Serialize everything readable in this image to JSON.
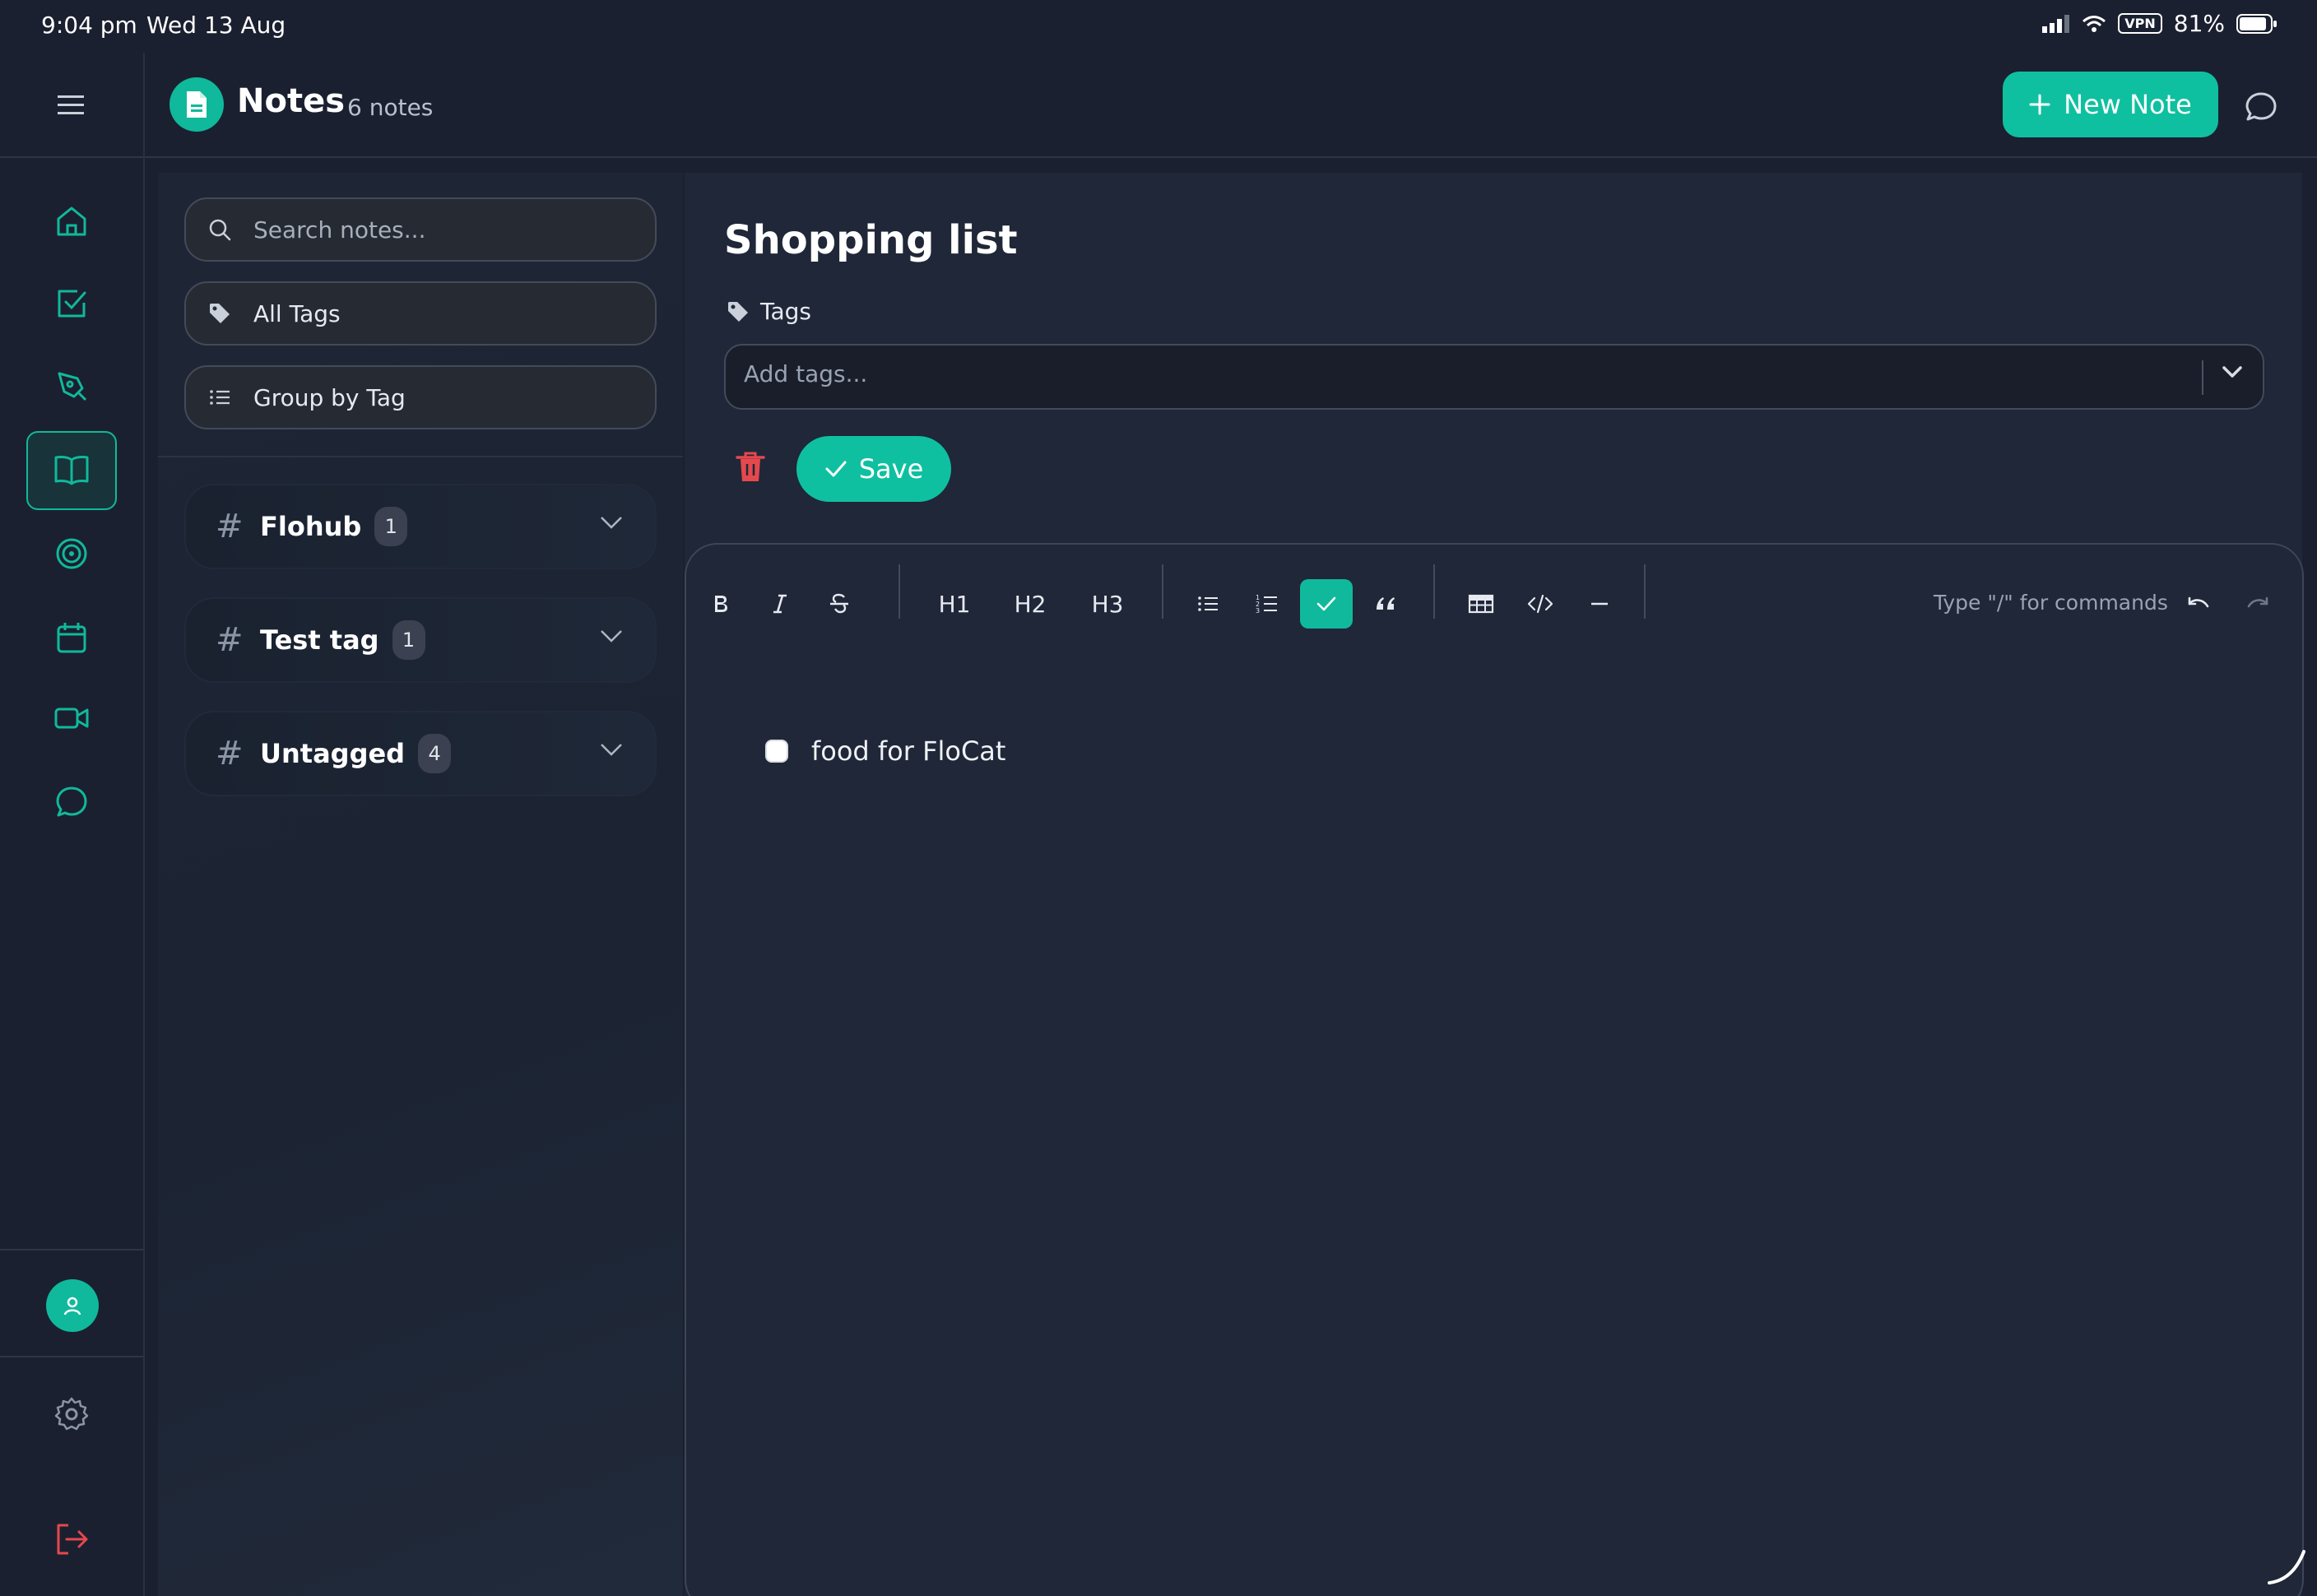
{
  "status_bar": {
    "time": "9:04 pm",
    "date": "Wed 13 Aug",
    "vpn": "VPN",
    "battery": "81%"
  },
  "header": {
    "title": "Notes",
    "note_count": "6 notes",
    "new_note_label": "New Note"
  },
  "rail": {
    "items": [
      "home-icon",
      "tasks-icon",
      "pen-icon",
      "notes-book-icon",
      "target-icon",
      "calendar-icon",
      "video-icon",
      "chat-icon"
    ],
    "active": "notes-book-icon"
  },
  "sidebar": {
    "search_placeholder": "Search notes...",
    "all_tags_label": "All Tags",
    "group_by_label": "Group by Tag",
    "tag_groups": [
      {
        "name": "Flohub",
        "count": "1"
      },
      {
        "name": "Test tag",
        "count": "1"
      },
      {
        "name": "Untagged",
        "count": "4"
      }
    ]
  },
  "editor": {
    "title": "Shopping list",
    "tags_label": "Tags",
    "tags_placeholder": "Add tags...",
    "save_label": "Save",
    "toolbar": {
      "h1": "H1",
      "h2": "H2",
      "h3": "H3",
      "hint": "Type \"/\" for commands"
    },
    "tasks": [
      {
        "text": "food for FloCat",
        "checked": false
      }
    ]
  },
  "colors": {
    "accent": "#0fc0a0",
    "background": "#1b2030",
    "danger": "#e5484d"
  }
}
